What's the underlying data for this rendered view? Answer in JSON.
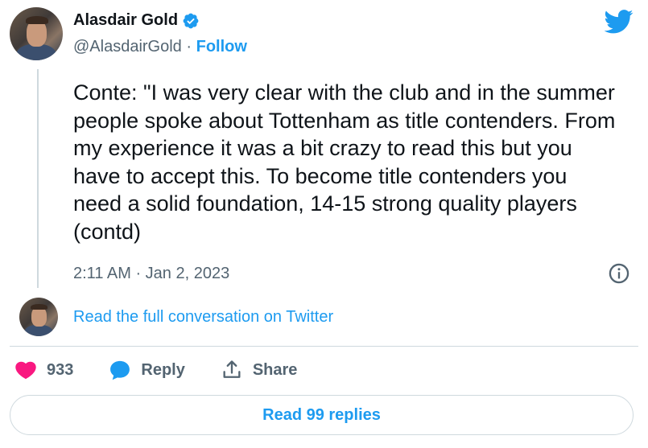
{
  "author": {
    "name": "Alasdair Gold",
    "handle": "@AlasdairGold",
    "separator": "·",
    "follow_label": "Follow"
  },
  "tweet": {
    "text": "Conte: \"I was very clear with the club and in the summer people spoke about Tottenham as title contenders. From my experience it was a bit crazy to read this but you have to accept this. To become title contenders you need a solid foundation, 14-15 strong quality players (contd)",
    "timestamp": "2:11 AM · Jan 2, 2023"
  },
  "conversation": {
    "link_text": "Read the full conversation on Twitter"
  },
  "actions": {
    "likes_count": "933",
    "reply_label": "Reply",
    "share_label": "Share"
  },
  "replies_button": {
    "label": "Read 99 replies"
  },
  "colors": {
    "accent": "#1d9bf0",
    "like": "#f91880",
    "text": "#0f1419",
    "muted": "#536471",
    "border": "#cfd9de"
  },
  "icons": [
    "verified-icon",
    "twitter-bird-icon",
    "info-icon",
    "heart-icon",
    "reply-icon",
    "share-icon"
  ]
}
